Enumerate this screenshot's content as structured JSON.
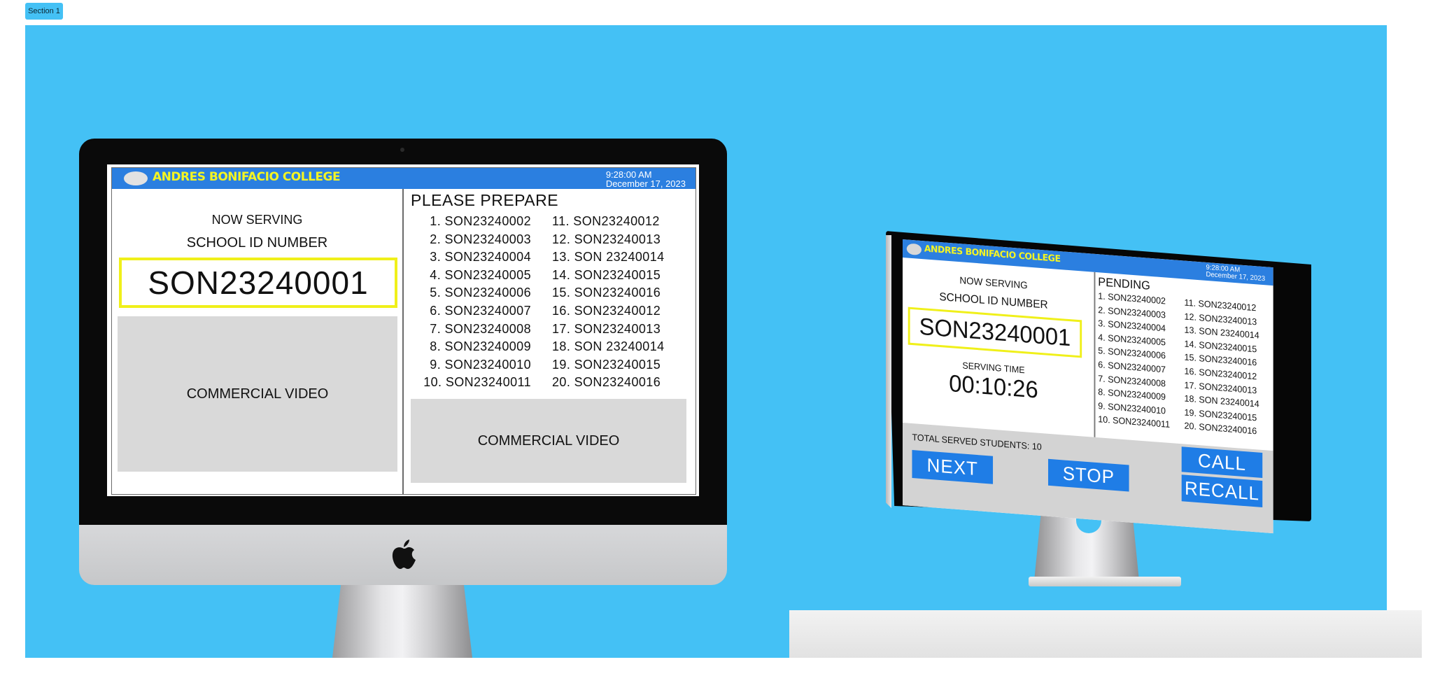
{
  "section_tag": "Section 1",
  "display": {
    "college": "ANDRES BONIFACIO COLLEGE",
    "time": "9:28:00 AM",
    "date": "December 17, 2023",
    "now_serving_label": "NOW SERVING",
    "school_id_label": "SCHOOL ID NUMBER",
    "current_id": "SON23240001",
    "video_label": "COMMERCIAL VIDEO",
    "prepare_heading": "PLEASE PREPARE",
    "queue_col1": [
      "1. SON23240002",
      "2. SON23240003",
      "3. SON23240004",
      "4. SON23240005",
      "5. SON23240006",
      "6. SON23240007",
      "7. SON23240008",
      "8. SON23240009",
      "9. SON23240010",
      "10. SON23240011"
    ],
    "queue_col2": [
      "11. SON23240012",
      "12. SON23240013",
      "13. SON 23240014",
      "14. SON23240015",
      "15. SON23240016",
      "16. SON23240012",
      "17. SON23240013",
      "18. SON 23240014",
      "19. SON23240015",
      "20. SON23240016"
    ]
  },
  "admin": {
    "college": "ANDRES BONIFACIO COLLEGE",
    "time": "9:28:00 AM",
    "date": "December 17, 2023",
    "now_serving_label": "NOW SERVING",
    "school_id_label": "SCHOOL ID NUMBER",
    "current_id": "SON23240001",
    "serving_time_label": "SERVING TIME",
    "serving_time": "00:10:26",
    "pending_heading": "PENDING",
    "pending_col1": [
      "1. SON23240002",
      "2. SON23240003",
      "3. SON23240004",
      "4. SON23240005",
      "5. SON23240006",
      "6. SON23240007",
      "7. SON23240008",
      "8. SON23240009",
      "9. SON23240010",
      "10. SON23240011"
    ],
    "pending_col2": [
      "11. SON23240012",
      "12. SON23240013",
      "13. SON 23240014",
      "14. SON23240015",
      "15. SON23240016",
      "16. SON23240012",
      "17. SON23240013",
      "18. SON 23240014",
      "19. SON23240015",
      "20. SON23240016"
    ],
    "total_served": "TOTAL SERVED STUDENTS: 10",
    "buttons": {
      "next": "NEXT",
      "stop": "STOP",
      "call": "CALL",
      "recall": "RECALL"
    }
  },
  "colors": {
    "backdrop": "#44c1f5",
    "header": "#2b7fe0",
    "college_text": "#f4f422",
    "id_border": "#f0f01a",
    "button": "#1f7de6",
    "video": "#d9d9d9"
  }
}
